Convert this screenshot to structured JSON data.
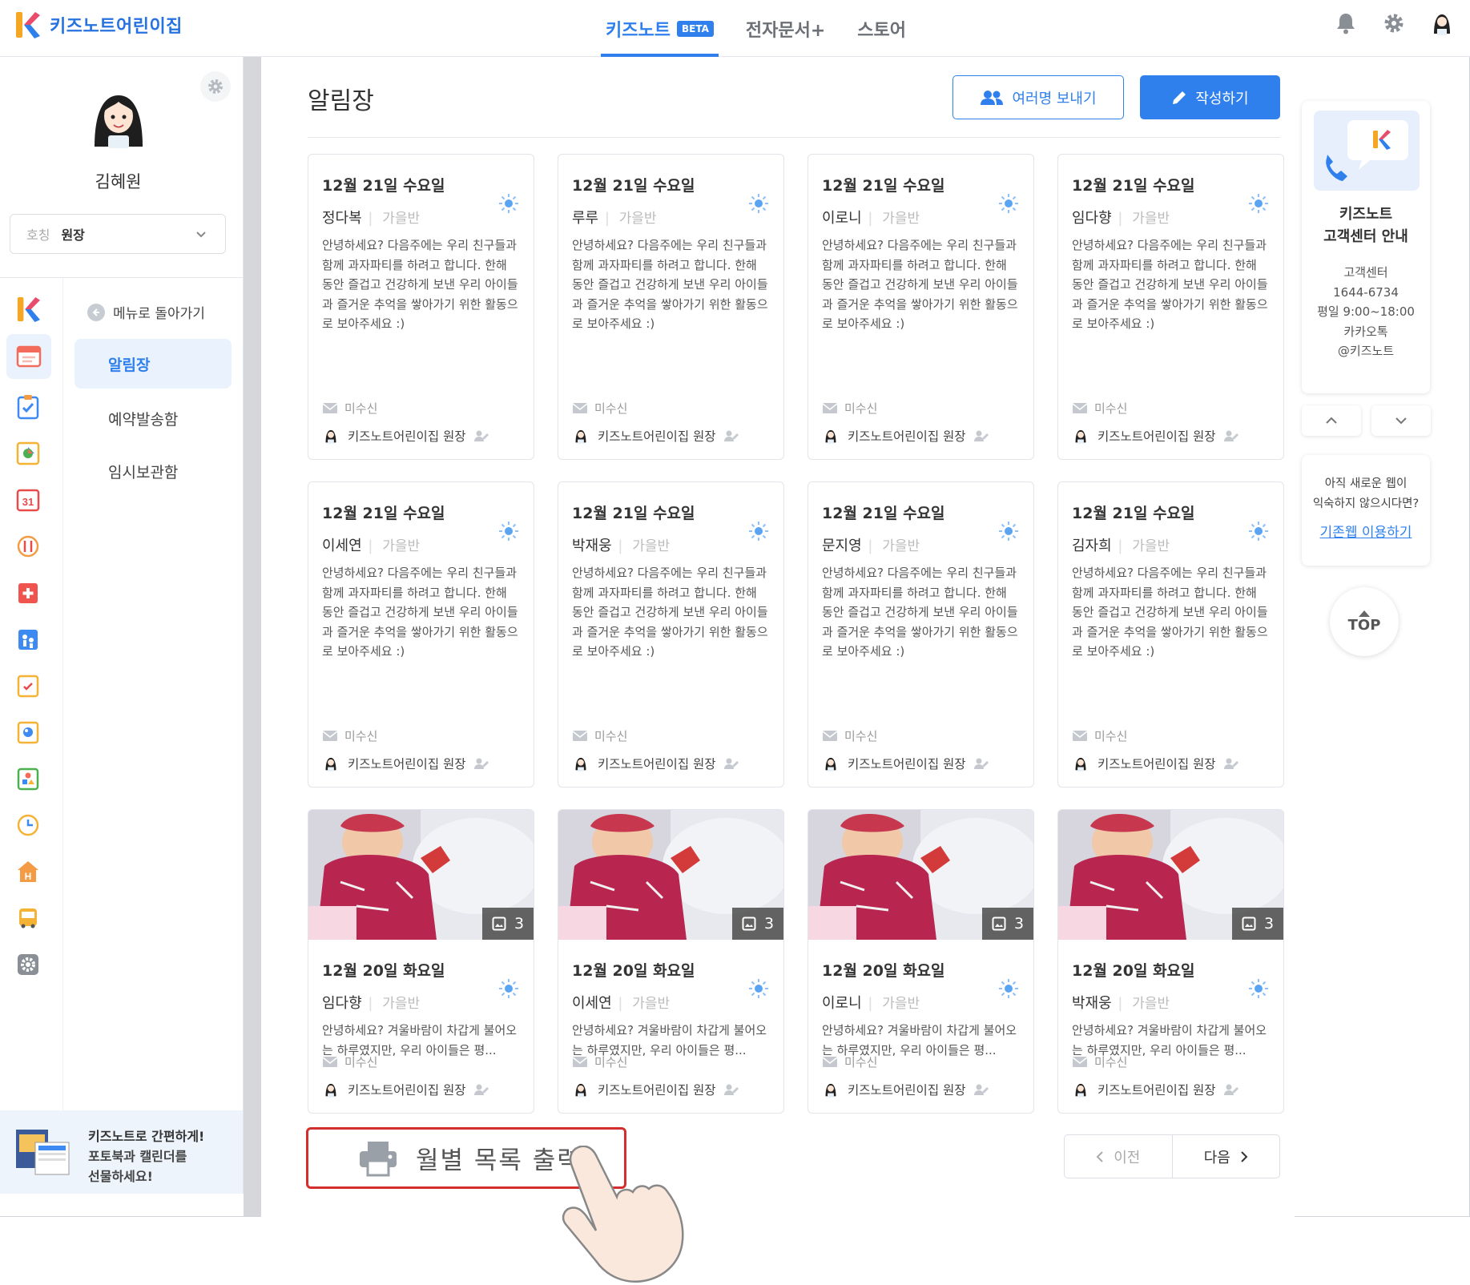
{
  "brand": {
    "name": "키즈노트어린이집"
  },
  "topnav": [
    {
      "label": "키즈노트",
      "badge": "BETA",
      "active": true
    },
    {
      "label": "전자문서+",
      "active": false
    },
    {
      "label": "스토어",
      "active": false
    }
  ],
  "profile": {
    "name": "김혜원",
    "role_label": "호칭",
    "role_value": "원장"
  },
  "submenu": {
    "back": "메뉴로 돌아가기",
    "items": [
      {
        "label": "알림장",
        "active": true
      },
      {
        "label": "예약발송함",
        "active": false
      },
      {
        "label": "임시보관함",
        "active": false
      }
    ]
  },
  "rail_icons": [
    "kidsnote-logo-icon",
    "notice-icon",
    "checklist-icon",
    "album-icon",
    "calendar-icon",
    "meal-icon",
    "medicine-icon",
    "attendance-icon",
    "survey-icon",
    "art-icon",
    "education-icon",
    "clock-icon",
    "home-icon",
    "bus-icon",
    "settings-icon"
  ],
  "calendar_icon_text": "31",
  "promo": {
    "line1": "키즈노트로 간편하게!",
    "line2": "포토북과 캘린더를",
    "line3": "선물하세요!"
  },
  "page": {
    "title": "알림장",
    "send_multi": "여러명 보내기",
    "compose": "작성하기"
  },
  "cards_text": {
    "status": "미수신",
    "author": "키즈노트어린이집 원장",
    "class_name": "가을반",
    "msg_long": "안녕하세요? 다음주에는 우리 친구들과 함께 과자파티를 하려고 합니다. 한해 동안 즐겁고 건강하게 보낸 우리 아이들과 즐거운 추억을 쌓아가기 위한 활동으로 보아주세요 :)",
    "msg_short": "안녕하세요? 겨울바람이 차갑게 불어오는 하루였지만, 우리 아이들은 평..."
  },
  "cards": [
    {
      "date": "12월 21일 수요일",
      "child": "정다복",
      "photo": false
    },
    {
      "date": "12월 21일 수요일",
      "child": "루루",
      "photo": false
    },
    {
      "date": "12월 21일 수요일",
      "child": "이로니",
      "photo": false
    },
    {
      "date": "12월 21일 수요일",
      "child": "임다향",
      "photo": false
    },
    {
      "date": "12월 21일 수요일",
      "child": "이세연",
      "photo": false
    },
    {
      "date": "12월 21일 수요일",
      "child": "박재웅",
      "photo": false
    },
    {
      "date": "12월 21일 수요일",
      "child": "문지영",
      "photo": false
    },
    {
      "date": "12월 21일 수요일",
      "child": "김자희",
      "photo": false
    },
    {
      "date": "12월 20일 화요일",
      "child": "임다향",
      "photo": true,
      "photo_count": "3"
    },
    {
      "date": "12월 20일 화요일",
      "child": "이세연",
      "photo": true,
      "photo_count": "3"
    },
    {
      "date": "12월 20일 화요일",
      "child": "이로니",
      "photo": true,
      "photo_count": "3"
    },
    {
      "date": "12월 20일 화요일",
      "child": "박재웅",
      "photo": true,
      "photo_count": "3"
    }
  ],
  "print": {
    "label": "월별 목록 출력"
  },
  "pager": {
    "prev": "이전",
    "next": "다음"
  },
  "support": {
    "title1": "키즈노트",
    "title2": "고객센터 안내",
    "info": [
      "고객센터",
      "1644-6734",
      "평일 9:00~18:00",
      "카카오톡",
      "@키즈노트"
    ]
  },
  "old_web": {
    "q1": "아직 새로운 웹이",
    "q2": "익숙하지 않으시다면?",
    "link": "기존웹 이용하기"
  },
  "top_button": "TOP",
  "colors": {
    "accent": "#2f80ed",
    "highlight": "#d32f2f"
  }
}
